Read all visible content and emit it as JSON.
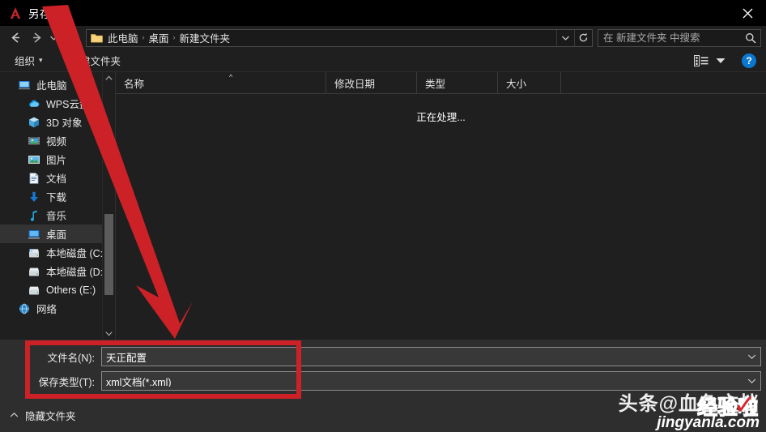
{
  "window": {
    "title": "另存为",
    "app_icon": "autocad-a-icon",
    "close_label": "✕"
  },
  "nav": {
    "back_icon": "arrow-left-icon",
    "forward_icon": "arrow-right-icon",
    "recent_icon": "chevron-down-icon",
    "up_icon": "arrow-up-icon",
    "breadcrumb": [
      "此电脑",
      "桌面",
      "新建文件夹"
    ],
    "separator": "›",
    "folder_icon": "folder-icon",
    "address_dropdown_icon": "chevron-down-icon",
    "refresh_icon": "refresh-icon"
  },
  "search": {
    "placeholder": "在 新建文件夹 中搜索",
    "value": "",
    "icon": "search-icon"
  },
  "toolbar": {
    "organize_label": "组织",
    "organize_caret": "▾",
    "new_folder_label": "新建文件夹",
    "view_icon": "list-view-icon",
    "view_caret_icon": "caret-down-icon",
    "help_label": "?"
  },
  "sidebar": {
    "items": [
      {
        "label": "此电脑",
        "icon": "computer-icon",
        "indent": false,
        "selected": false
      },
      {
        "label": "WPS云盘",
        "icon": "cloud-icon",
        "indent": true,
        "selected": false
      },
      {
        "label": "3D 对象",
        "icon": "cube-icon",
        "indent": true,
        "selected": false
      },
      {
        "label": "视频",
        "icon": "video-icon",
        "indent": true,
        "selected": false
      },
      {
        "label": "图片",
        "icon": "picture-icon",
        "indent": true,
        "selected": false
      },
      {
        "label": "文档",
        "icon": "document-icon",
        "indent": true,
        "selected": false
      },
      {
        "label": "下载",
        "icon": "download-icon",
        "indent": true,
        "selected": false
      },
      {
        "label": "音乐",
        "icon": "music-icon",
        "indent": true,
        "selected": false
      },
      {
        "label": "桌面",
        "icon": "desktop-icon",
        "indent": true,
        "selected": true
      },
      {
        "label": "本地磁盘 (C:)",
        "icon": "system-drive-icon",
        "indent": true,
        "selected": false
      },
      {
        "label": "本地磁盘 (D:)",
        "icon": "drive-icon",
        "indent": true,
        "selected": false
      },
      {
        "label": "Others (E:)",
        "icon": "drive-icon",
        "indent": true,
        "selected": false
      },
      {
        "label": "网络",
        "icon": "network-icon",
        "indent": false,
        "selected": false
      }
    ],
    "scroll_up_icon": "chevron-up-icon",
    "scroll_down_icon": "chevron-down-icon"
  },
  "filelist": {
    "columns": [
      "名称",
      "修改日期",
      "类型",
      "大小"
    ],
    "sort_indicator": "^",
    "status_message": "正在处理...",
    "rows": []
  },
  "form": {
    "filename_label": "文件名(N):",
    "filename_value": "天正配置",
    "filetype_label": "保存类型(T):",
    "filetype_value": "xml文档(*.xml)",
    "caret_icon": "chevron-down-icon"
  },
  "footer": {
    "hide_folders_label": "隐藏文件夹",
    "hide_caret_icon": "chevron-up-icon"
  },
  "annotations": {
    "highlight_color": "#cc2127",
    "arrow_color": "#cc2127"
  },
  "watermark": {
    "line1": "头条@血色文档",
    "line1_overlay": "经验啦",
    "line2": "jingyanla.com",
    "check_mark": "✓"
  }
}
